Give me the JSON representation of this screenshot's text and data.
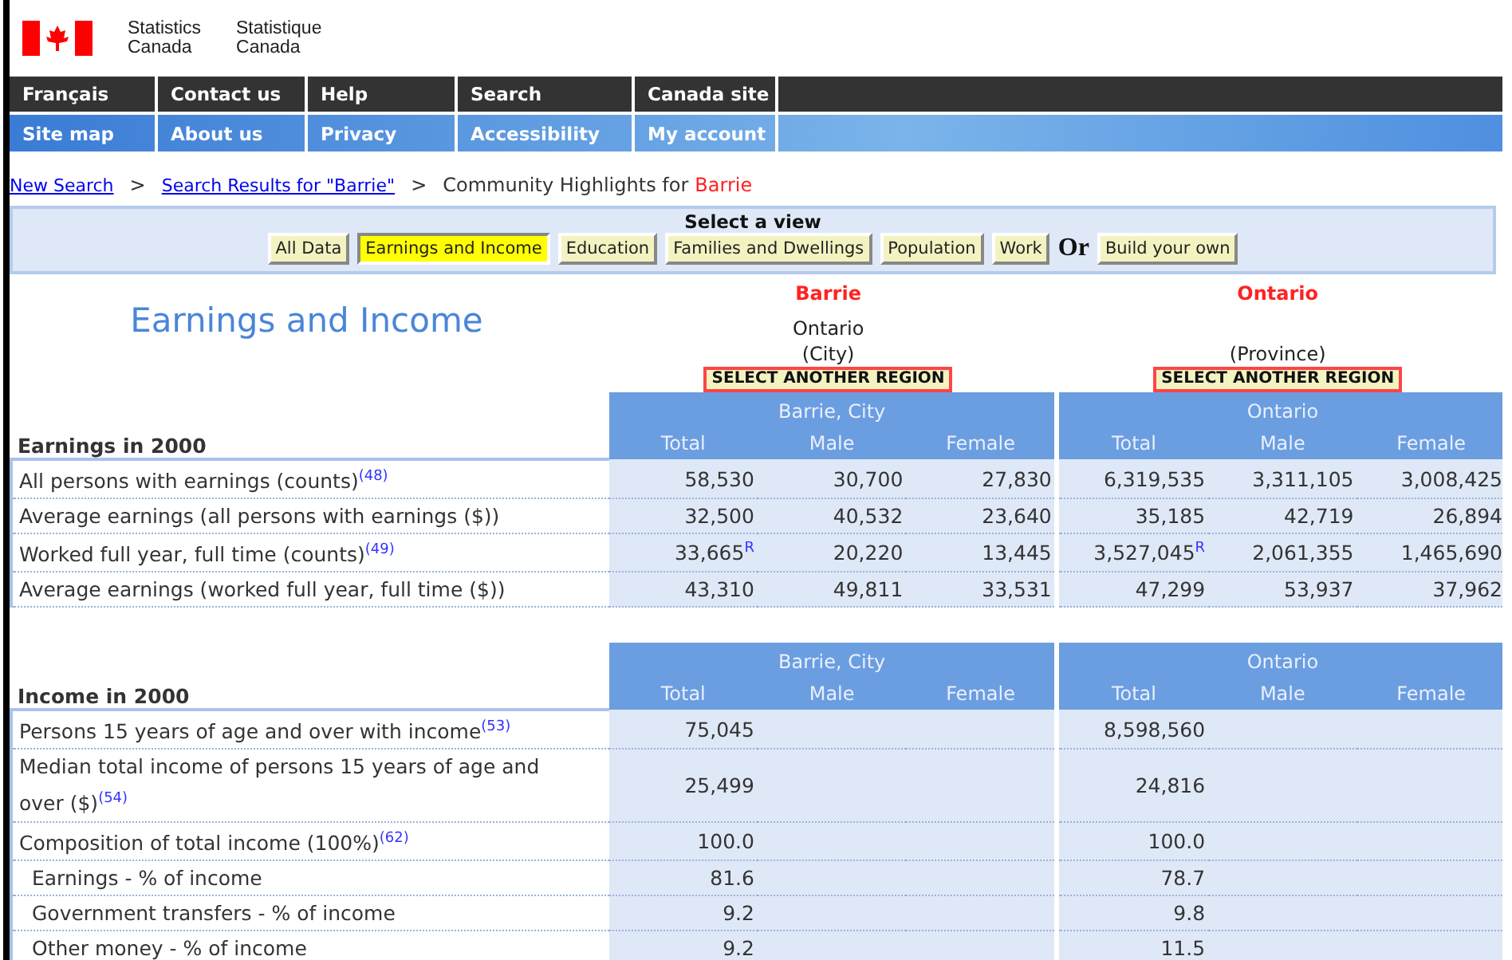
{
  "header": {
    "name_en": "Statistics\nCanada",
    "name_fr": "Statistique\nCanada"
  },
  "nav_rows": [
    {
      "kind": "dark",
      "items": [
        "Français",
        "Contact us",
        "Help",
        "Search",
        "Canada site"
      ]
    },
    {
      "kind": "blue",
      "items": [
        "Site map",
        "About us",
        "Privacy",
        "Accessibility",
        "My account"
      ]
    }
  ],
  "breadcrumb": {
    "links": [
      "New Search",
      "Search Results for \"Barrie\""
    ],
    "separator": ">",
    "current": "Community Highlights for",
    "place": "Barrie"
  },
  "view_selector": {
    "title": "Select a view",
    "buttons": [
      {
        "label": "All Data",
        "selected": false
      },
      {
        "label": "Earnings and Income",
        "selected": true
      },
      {
        "label": "Education",
        "selected": false
      },
      {
        "label": "Families and Dwellings",
        "selected": false
      },
      {
        "label": "Population",
        "selected": false
      },
      {
        "label": "Work",
        "selected": false
      }
    ],
    "or_label": "Or",
    "build_button": "Build your own"
  },
  "page_title": "Earnings and Income",
  "regions": [
    {
      "name": "Barrie",
      "lines": [
        "Ontario",
        "(City)"
      ],
      "button": "SELECT ANOTHER REGION"
    },
    {
      "name": "Ontario",
      "lines": [
        "(Province)"
      ],
      "button": "SELECT ANOTHER REGION"
    }
  ],
  "sections": [
    {
      "title": "Earnings in 2000",
      "groups": [
        {
          "name": "Barrie, City",
          "columns": [
            "Total",
            "Male",
            "Female"
          ]
        },
        {
          "name": "Ontario",
          "columns": [
            "Total",
            "Male",
            "Female"
          ]
        }
      ],
      "rows": [
        {
          "label": "All persons with earnings (counts)",
          "note": "(48)",
          "indent": false,
          "values": [
            [
              "58,530",
              "30,700",
              "27,830"
            ],
            [
              "6,319,535",
              "3,311,105",
              "3,008,425"
            ]
          ]
        },
        {
          "label": "Average earnings (all persons with earnings ($))",
          "indent": false,
          "values": [
            [
              "32,500",
              "40,532",
              "23,640"
            ],
            [
              "35,185",
              "42,719",
              "26,894"
            ]
          ]
        },
        {
          "label": "Worked full year, full time (counts)",
          "note": "(49)",
          "indent": false,
          "values": [
            [
              "33,665$^{R}$",
              "20,220",
              "13,445"
            ],
            [
              "3,527,045$^{R}$",
              "2,061,355",
              "1,465,690"
            ]
          ]
        },
        {
          "label": "Average earnings (worked full year, full time ($))",
          "indent": false,
          "values": [
            [
              "43,310",
              "49,811",
              "33,531"
            ],
            [
              "47,299",
              "53,937",
              "37,962"
            ]
          ]
        }
      ]
    },
    {
      "title": "Income in 2000",
      "groups": [
        {
          "name": "Barrie, City",
          "columns": [
            "Total",
            "Male",
            "Female"
          ]
        },
        {
          "name": "Ontario",
          "columns": [
            "Total",
            "Male",
            "Female"
          ]
        }
      ],
      "rows": [
        {
          "label": "Persons 15 years of age and over with income",
          "note": "(53)",
          "indent": false,
          "values": [
            [
              "75,045"
            ],
            [
              "8,598,560"
            ]
          ]
        },
        {
          "label": "Median total income of persons 15 years of age and over ($)",
          "note": "(54)",
          "indent": false,
          "values": [
            [
              "25,499"
            ],
            [
              "24,816"
            ]
          ]
        },
        {
          "label": "Composition of total income (100%)",
          "note": "(62)",
          "indent": false,
          "values": [
            [
              "100.0"
            ],
            [
              "100.0"
            ]
          ]
        },
        {
          "label": "Earnings - % of income",
          "indent": true,
          "values": [
            [
              "81.6"
            ],
            [
              "78.7"
            ]
          ]
        },
        {
          "label": "Government transfers - % of income",
          "indent": true,
          "values": [
            [
              "9.2"
            ],
            [
              "9.8"
            ]
          ]
        },
        {
          "label": "Other money - % of income",
          "indent": true,
          "values": [
            [
              "9.2"
            ],
            [
              "11.5"
            ]
          ]
        }
      ]
    }
  ]
}
